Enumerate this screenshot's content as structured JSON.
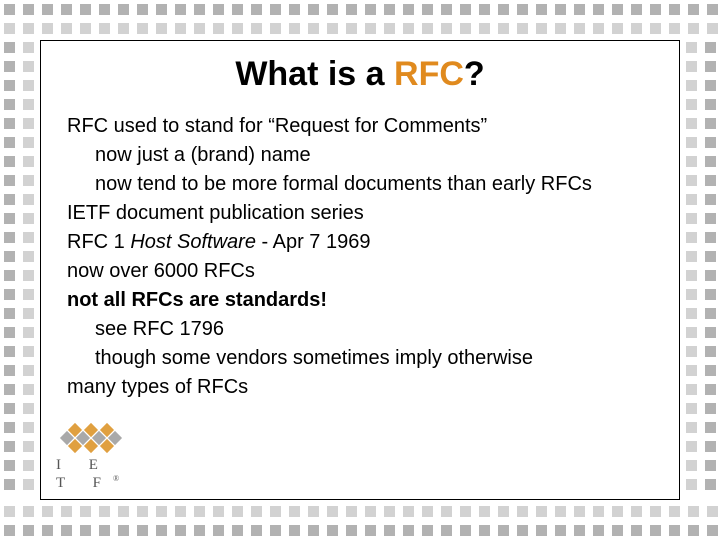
{
  "title": {
    "pre": "What is a ",
    "accent": "RFC",
    "post": "?"
  },
  "lines": {
    "l1": "RFC used to stand for “Request for Comments”",
    "l2": "now just a (brand) name",
    "l3": "now tend to be more formal documents than early RFCs",
    "l4": "IETF document publication series",
    "l5_a": "RFC 1 ",
    "l5_b": "Host Software",
    "l5_c": " - Apr 7 1969",
    "l6": "now over 6000 RFCs",
    "l7": "not all RFCs are standards!",
    "l8": "see RFC 1796",
    "l9": "though some vendors sometimes imply otherwise",
    "l10": "many types of RFCs"
  },
  "logo": {
    "letters": "I E T F"
  }
}
